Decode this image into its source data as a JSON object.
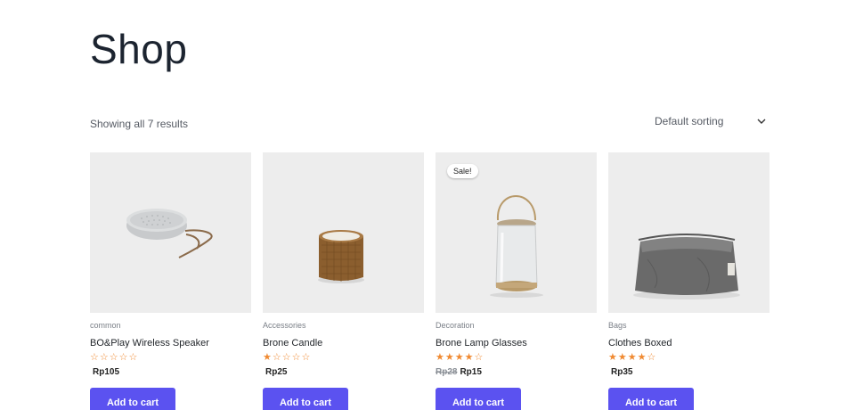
{
  "page": {
    "title": "Shop"
  },
  "toolbar": {
    "result_count": "Showing all 7 results",
    "sort": {
      "selected": "Default sorting",
      "icon": "chevron-down-icon"
    }
  },
  "products": [
    {
      "category": "common",
      "name": "BO&Play Wireless Speaker",
      "rating": 0,
      "price": "Rp105",
      "old_price": "",
      "sale": "",
      "button": "Add to cart",
      "image": "speaker"
    },
    {
      "category": "Accessories",
      "name": "Brone Candle",
      "rating": 1,
      "price": "Rp25",
      "old_price": "",
      "sale": "",
      "button": "Add to cart",
      "image": "candle"
    },
    {
      "category": "Decoration",
      "name": "Brone Lamp Glasses",
      "rating": 4,
      "price": "Rp15",
      "old_price": "Rp28",
      "sale": "Sale!",
      "button": "Add to cart",
      "image": "lantern"
    },
    {
      "category": "Bags",
      "name": "Clothes Boxed",
      "rating": 4,
      "price": "Rp35",
      "old_price": "",
      "sale": "",
      "button": "Add to cart",
      "image": "basket"
    }
  ],
  "colors": {
    "accent": "#5b52f0",
    "star": "#f08a32",
    "thumb_bg": "#ededed"
  }
}
